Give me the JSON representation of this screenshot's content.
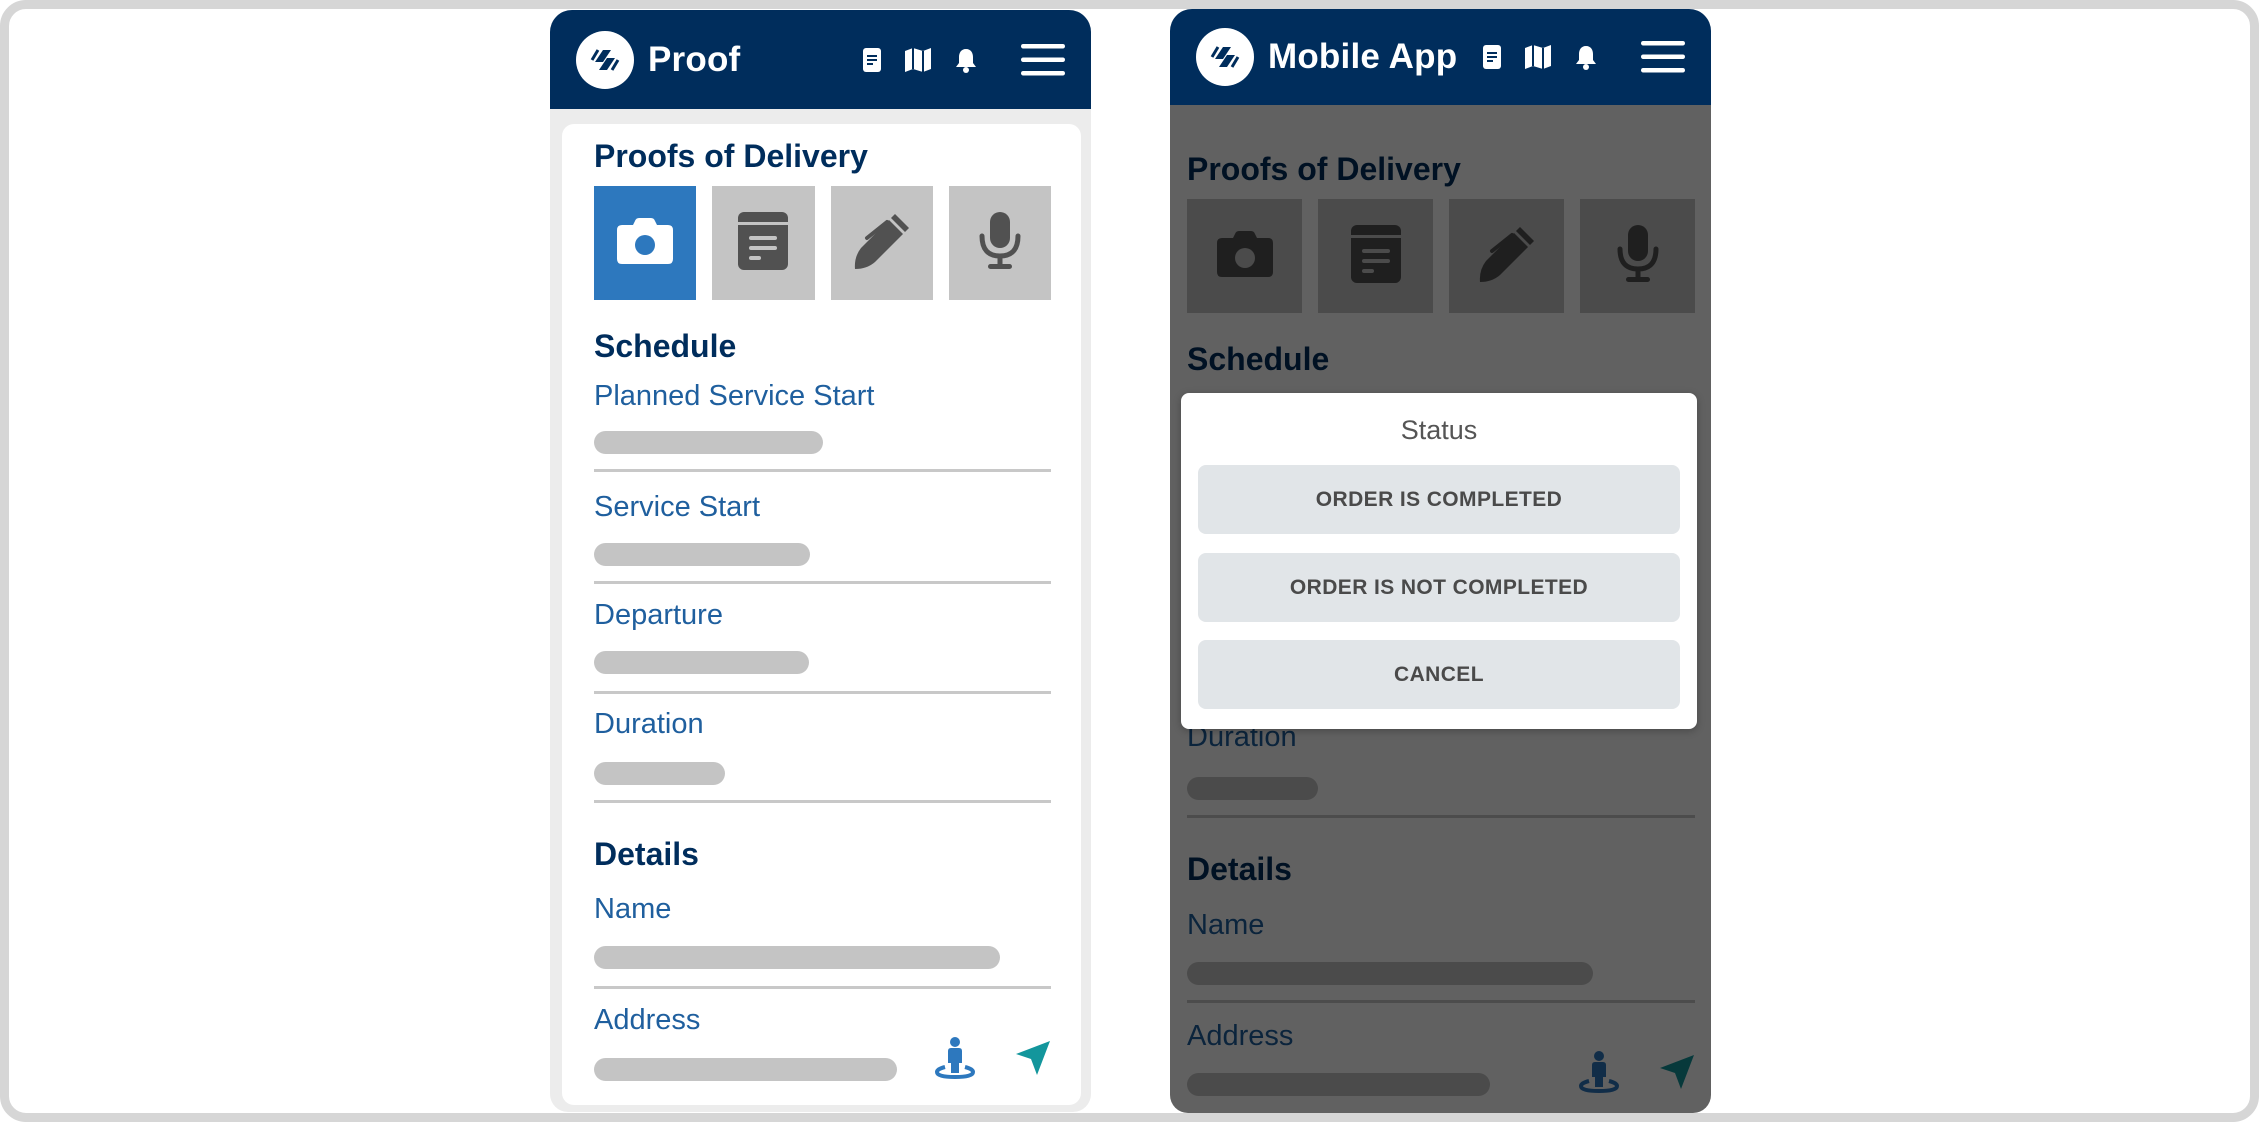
{
  "left_screen": {
    "app_title": "Proof",
    "header_icons": [
      "document-icon",
      "map-icon",
      "bell-icon",
      "menu-icon"
    ],
    "proofs_title": "Proofs of Delivery",
    "proof_tiles": [
      {
        "name": "camera",
        "icon": "camera-icon",
        "active": true
      },
      {
        "name": "note",
        "icon": "note-icon",
        "active": false
      },
      {
        "name": "signature",
        "icon": "pen-icon",
        "active": false
      },
      {
        "name": "voice",
        "icon": "microphone-icon",
        "active": false
      }
    ],
    "schedule_title": "Schedule",
    "schedule_fields": [
      {
        "label": "Planned Service Start",
        "value": ""
      },
      {
        "label": "Service Start",
        "value": ""
      },
      {
        "label": "Departure",
        "value": ""
      },
      {
        "label": "Duration",
        "value": ""
      }
    ],
    "details_title": "Details",
    "details_fields": [
      {
        "label": "Name",
        "value": ""
      },
      {
        "label": "Address",
        "value": "",
        "actions": [
          "street-view-icon",
          "navigate-icon"
        ]
      }
    ]
  },
  "right_screen": {
    "app_title": "Mobile App",
    "header_icons": [
      "document-icon",
      "map-icon",
      "bell-icon",
      "menu-icon"
    ],
    "proofs_title": "Proofs of Delivery",
    "schedule_title": "Schedule",
    "details_title": "Details",
    "duration_label": "Duration",
    "name_label": "Name",
    "address_label": "Address",
    "dialog": {
      "title": "Status",
      "buttons": [
        "ORDER IS COMPLETED",
        "ORDER IS NOT COMPLETED",
        "CANCEL"
      ]
    }
  },
  "colors": {
    "header_bg": "#002d5c",
    "accent_blue": "#2d78be",
    "label_blue": "#1f5f9e",
    "tile_gray": "#c4c4c4",
    "navigate_teal": "#13969c",
    "dialog_button_bg": "#e1e5e8"
  }
}
